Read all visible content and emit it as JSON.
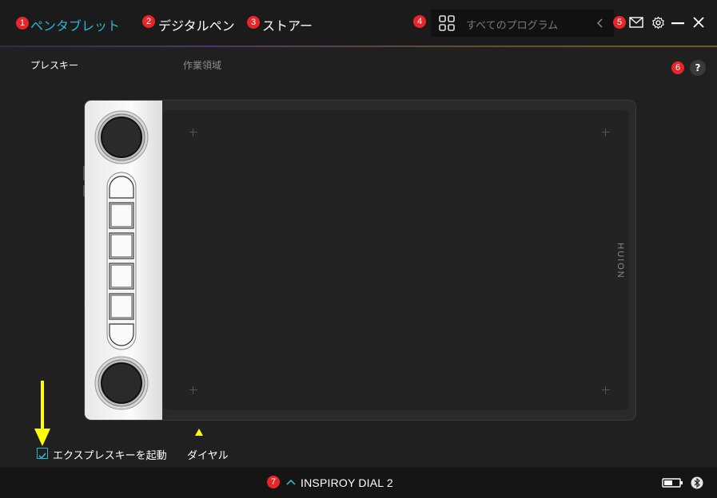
{
  "nav": {
    "tabs": [
      {
        "number": "1",
        "label": "ペンタブレット",
        "active": true
      },
      {
        "number": "2",
        "label": "デジタルペン",
        "active": false
      },
      {
        "number": "3",
        "label": "ストアー",
        "active": false
      }
    ],
    "search": {
      "number": "4",
      "placeholder": "すべてのプログラム",
      "icon": "grid-icon"
    },
    "mail_number": "5",
    "icons": [
      "mail-icon",
      "gear-icon",
      "minimize-icon",
      "close-icon"
    ]
  },
  "subtabs": {
    "items": [
      "プレスキー",
      "作業領域"
    ],
    "help_number": "6",
    "help_label": "?"
  },
  "tablet": {
    "brand": "HUION",
    "express_keys": 4
  },
  "options": {
    "enable_express_keys": "エクスプレスキーを起動",
    "enable_checked": true,
    "dial_label": "ダイヤル"
  },
  "footer": {
    "number": "7",
    "device_name": "INSPIROY DIAL 2",
    "icons": [
      "chevron-up-icon",
      "battery-icon",
      "bluetooth-icon"
    ]
  },
  "colors": {
    "accent": "#2fb4d6",
    "badge": "#e8262a",
    "annotation_arrow": "#ffff00"
  }
}
